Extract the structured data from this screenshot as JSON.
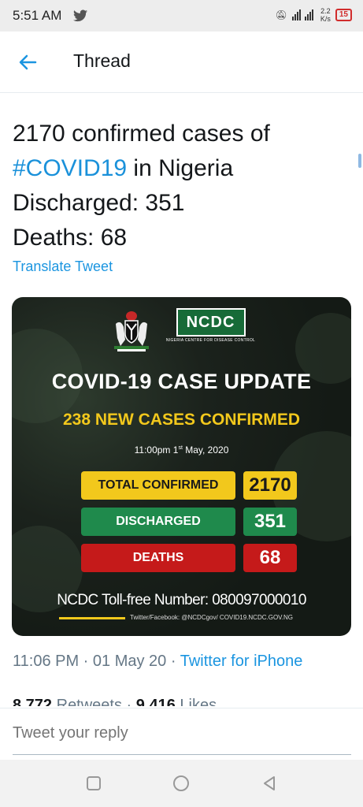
{
  "status_bar": {
    "time": "5:51 AM",
    "network_speed_value": "2.2",
    "network_speed_unit": "K/s",
    "battery": "15"
  },
  "header": {
    "title": "Thread"
  },
  "tweet": {
    "line1": "2170 confirmed cases of",
    "hashtag": "#COVID19",
    "line2_rest": " in Nigeria",
    "line3": "Discharged: 351",
    "line4": "Deaths: 68",
    "translate_label": "Translate Tweet"
  },
  "media": {
    "ncdc_logo_text": "NCDC",
    "ncdc_subtitle": "NIGERIA CENTRE FOR DISEASE CONTROL",
    "title": "COVID-19 CASE UPDATE",
    "new_cases": "238 NEW CASES CONFIRMED",
    "date_time": "11:00pm 1",
    "date_sup": "st",
    "date_rest": " May, 2020",
    "stats": [
      {
        "label": "TOTAL CONFIRMED",
        "value": "2170",
        "label_bg": "#f2c81c",
        "label_color": "#1a1a1a",
        "value_bg": "#f2c81c",
        "value_color": "#1a1a1a"
      },
      {
        "label": "DISCHARGED",
        "value": "351",
        "label_bg": "#1f8a4c",
        "label_color": "#ffffff",
        "value_bg": "#1f8a4c",
        "value_color": "#ffffff"
      },
      {
        "label": "DEATHS",
        "value": "68",
        "label_bg": "#c51a1a",
        "label_color": "#ffffff",
        "value_bg": "#c51a1a",
        "value_color": "#ffffff"
      }
    ],
    "tollfree": "NCDC Toll-free Number: 080097000010",
    "social": "Twitter/Facebook: @NCDCgov/ COVID19.NCDC.GOV.NG"
  },
  "meta": {
    "time": "11:06 PM",
    "sep1": " · ",
    "date": "01 May 20",
    "sep2": " · ",
    "source": "Twitter for iPhone"
  },
  "stats_line": {
    "retweets_count": "8,772",
    "retweets_label": " Retweets",
    "likes_sep": " · ",
    "likes_count": "9,416",
    "likes_label": " Likes"
  },
  "reply": {
    "placeholder": "Tweet your reply"
  },
  "colors": {
    "accent": "#1b95e0",
    "yellow": "#f2c81c",
    "green": "#1f8a4c",
    "red": "#c51a1a"
  }
}
